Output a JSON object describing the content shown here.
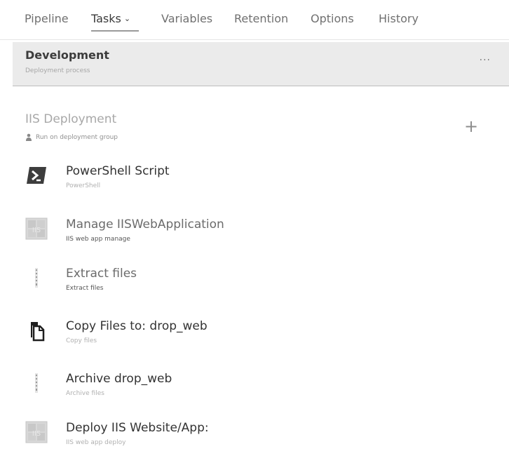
{
  "tabs": [
    {
      "label": "Pipeline"
    },
    {
      "label": "Tasks"
    },
    {
      "label": "Variables"
    },
    {
      "label": "Retention"
    },
    {
      "label": "Options"
    },
    {
      "label": "History"
    }
  ],
  "stage": {
    "title": "Development",
    "subtitle": "Deployment process",
    "more_label": "···"
  },
  "phase": {
    "title": "IIS Deployment",
    "subtitle": "Run on deployment group",
    "add_label": "+"
  },
  "tasks": [
    {
      "name": "PowerShell Script",
      "type": "PowerShell",
      "icon": "powershell-icon"
    },
    {
      "name": "Manage IISWebApplication",
      "type": "IIS web app manage",
      "icon": "iis-icon"
    },
    {
      "name": "Extract files",
      "type": "Extract files",
      "icon": "zip-icon"
    },
    {
      "name": "Copy Files to: drop_web",
      "type": "Copy files",
      "icon": "copy-files-icon"
    },
    {
      "name": "Archive drop_web",
      "type": "Archive files",
      "icon": "zip-icon"
    },
    {
      "name": "Deploy IIS Website/App:",
      "type": "IIS web app deploy",
      "icon": "iis-icon"
    }
  ]
}
